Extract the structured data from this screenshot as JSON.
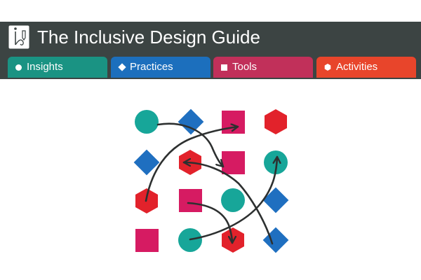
{
  "header": {
    "title": "The Inclusive Design Guide",
    "logo_icon": "pencil-logo-icon",
    "background": "#3c4443"
  },
  "tabs": [
    {
      "label": "Insights",
      "icon": "circle-icon",
      "color": "#1a9383"
    },
    {
      "label": "Practices",
      "icon": "diamond-icon",
      "color": "#1c6fbd"
    },
    {
      "label": "Tools",
      "icon": "square-icon",
      "color": "#c1305a"
    },
    {
      "label": "Activities",
      "icon": "hexagon-icon",
      "color": "#e8452b"
    }
  ],
  "illustration": {
    "shape_colors": {
      "circle": "#17a699",
      "diamond": "#1f6fc0",
      "square": "#d61b62",
      "hexagon": "#e2222b"
    },
    "arrow_color": "#2d3030"
  }
}
